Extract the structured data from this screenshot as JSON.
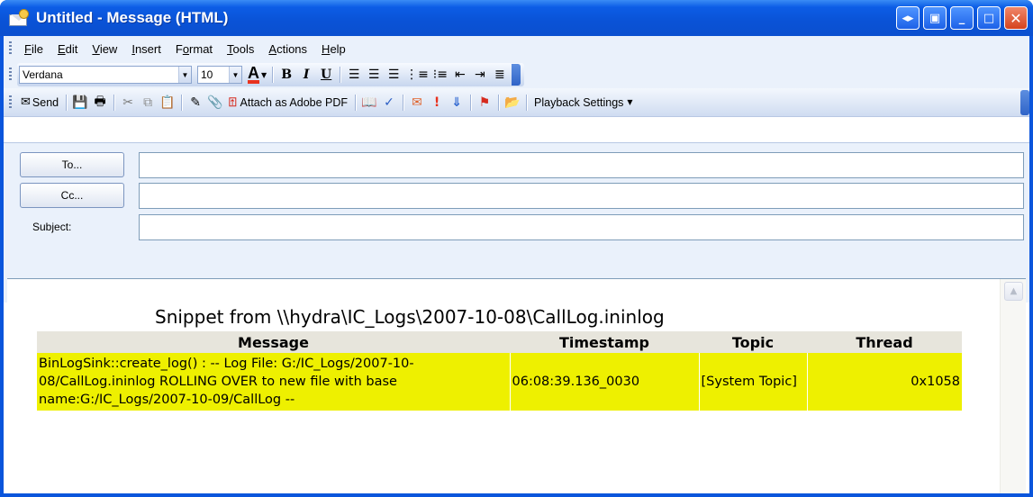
{
  "window": {
    "title": "Untitled - Message (HTML)"
  },
  "menu": {
    "items": [
      {
        "label": "File",
        "accel": "F",
        "rest": "ile"
      },
      {
        "label": "Edit",
        "accel": "E",
        "rest": "dit"
      },
      {
        "label": "View",
        "accel": "V",
        "rest": "iew"
      },
      {
        "label": "Insert",
        "accel": "I",
        "rest": "nsert"
      },
      {
        "label": "Format",
        "pre": "F",
        "accel": "o",
        "rest": "rmat"
      },
      {
        "label": "Tools",
        "accel": "T",
        "rest": "ools"
      },
      {
        "label": "Actions",
        "accel": "A",
        "rest": "ctions"
      },
      {
        "label": "Help",
        "accel": "H",
        "rest": "elp"
      }
    ]
  },
  "format_toolbar": {
    "font_name": "Verdana",
    "font_size": "10"
  },
  "standard_toolbar": {
    "send_label": "Send",
    "attach_pdf_label": "Attach as Adobe PDF",
    "playback_label": "Playback Settings"
  },
  "header": {
    "to_label": "To...",
    "cc_label": "Cc...",
    "subject_label": "Subject:",
    "to_value": "",
    "cc_value": "",
    "subject_value": ""
  },
  "body": {
    "snippet_title": "Snippet from \\\\hydra\\IC_Logs\\2007-10-08\\CallLog.ininlog",
    "table": {
      "columns": [
        "Message",
        "Timestamp",
        "Topic",
        "Thread"
      ],
      "rows": [
        {
          "message": "BinLogSink::create_log() : -- Log File: G:/IC_Logs/2007-10-08/CallLog.ininlog ROLLING OVER to new file with base name:G:/IC_Logs/2007-10-09/CallLog --",
          "timestamp": "06:08:39.136_0030",
          "topic": "[System Topic]",
          "thread": "0x1058"
        }
      ]
    }
  },
  "colors": {
    "titlebar": "#0a52d6",
    "row_highlight": "#eef000",
    "header_bg": "#e7e5dc",
    "chrome_bg": "#eaf1fb"
  },
  "icons": {
    "send": "envelope-icon",
    "save": "save-icon",
    "print": "print-icon",
    "cut": "cut-icon",
    "copy": "copy-icon",
    "paste": "paste-icon",
    "check_names": "check-names-icon",
    "attach": "paperclip-icon",
    "pdf": "pdf-icon",
    "address_book": "address-book-icon",
    "spelling": "spelling-icon",
    "options": "options-icon",
    "high_importance": "high-importance-icon",
    "low_importance": "low-importance-icon",
    "flag": "flag-icon",
    "permission": "permission-icon"
  }
}
